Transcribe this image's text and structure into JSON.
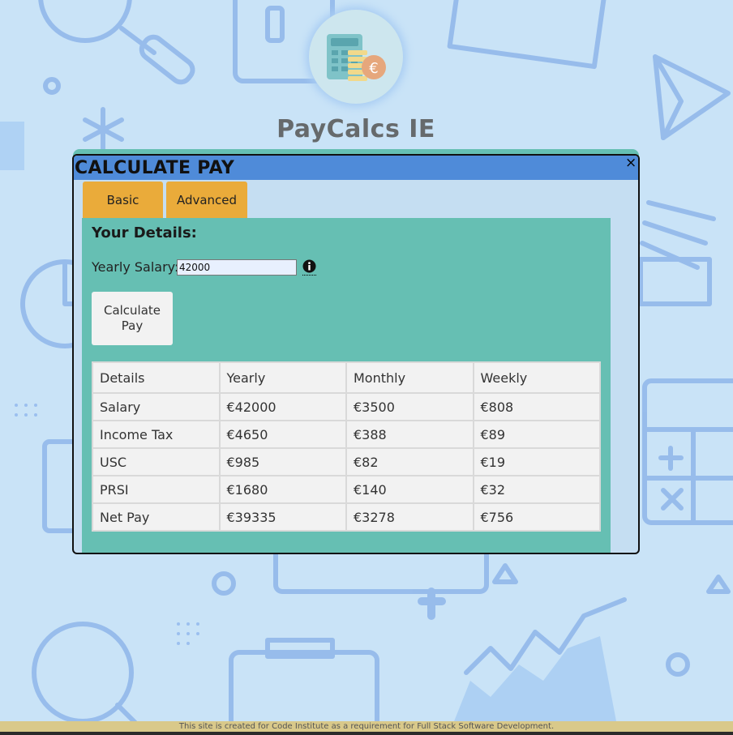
{
  "site": {
    "title": "PayCalcs IE",
    "logo_icon": "calculator-coins-euro-icon"
  },
  "modal": {
    "title": "CALCULATE PAY",
    "close_label": "×",
    "tabs": [
      {
        "label": "Basic",
        "active": true
      },
      {
        "label": "Advanced",
        "active": false
      }
    ],
    "details_heading": "Your Details:",
    "salary_label": "Yearly Salary:",
    "salary_value": "42000",
    "info_icon": "info-circle-icon",
    "calculate_button": [
      "Calculate",
      "Pay"
    ],
    "table": {
      "headers": [
        "Details",
        "Yearly",
        "Monthly",
        "Weekly"
      ],
      "rows": [
        [
          "Salary",
          "€42000",
          "€3500",
          "€808"
        ],
        [
          "Income Tax",
          "€4650",
          "€388",
          "€89"
        ],
        [
          "USC",
          "€985",
          "€82",
          "€19"
        ],
        [
          "PRSI",
          "€1680",
          "€140",
          "€32"
        ],
        [
          "Net Pay",
          "€39335",
          "€3278",
          "€756"
        ]
      ]
    }
  },
  "footer": {
    "text": "This site is created for Code Institute as a requirement for Full Stack Software Development."
  },
  "colors": {
    "background": "#c9e3f7",
    "header_blue": "#4f8bd9",
    "tab_orange": "#eaab3a",
    "panel_teal": "#66bfb3",
    "footer_tan": "#d9c98a"
  }
}
